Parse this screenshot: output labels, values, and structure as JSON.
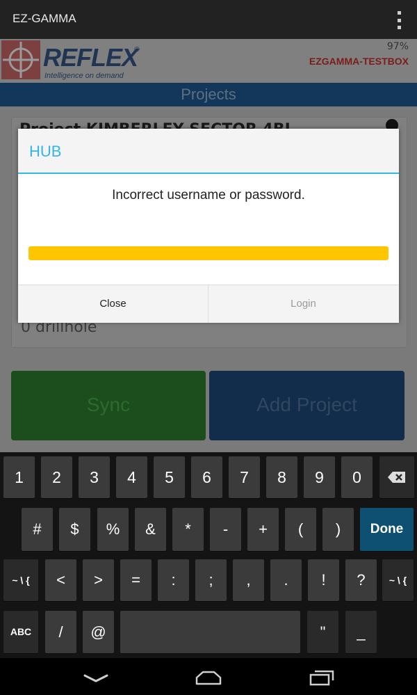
{
  "actionbar": {
    "title": "EZ-GAMMA",
    "overflow_icon": "more-vert-icon"
  },
  "header": {
    "logo_text": "REFLEX",
    "logo_reg": "®",
    "logo_tagline": "Intelligence on demand",
    "battery": "97%",
    "environment": "EZGAMMA-TESTBOX"
  },
  "page": {
    "title": "Projects"
  },
  "project_card": {
    "title": "Project KIMBERLEY SECTOR 4BL",
    "drillholes": "0 drillhole"
  },
  "buttons": {
    "sync": "Sync",
    "add_project": "Add Project"
  },
  "dialog": {
    "title": "HUB",
    "message": "Incorrect username or password.",
    "progress_color": "#ffc600",
    "close_label": "Close",
    "login_label": "Login"
  },
  "keyboard": {
    "row1": [
      "1",
      "2",
      "3",
      "4",
      "5",
      "6",
      "7",
      "8",
      "9",
      "0"
    ],
    "row2": [
      "#",
      "$",
      "%",
      "&",
      "*",
      "-",
      "+",
      "(",
      ")"
    ],
    "done_label": "Done",
    "row3_toggle": "~ \\ {",
    "row3": [
      "<",
      ">",
      "=",
      ":",
      ";",
      ",",
      ".",
      "!",
      "?"
    ],
    "row4_abc": "ABC",
    "row4": [
      "/",
      "@"
    ],
    "row4_right": [
      "\"",
      "_"
    ]
  },
  "colors": {
    "accent": "#33b5e5",
    "dialog_progress": "#ffc600",
    "done_key": "#0e5071"
  }
}
